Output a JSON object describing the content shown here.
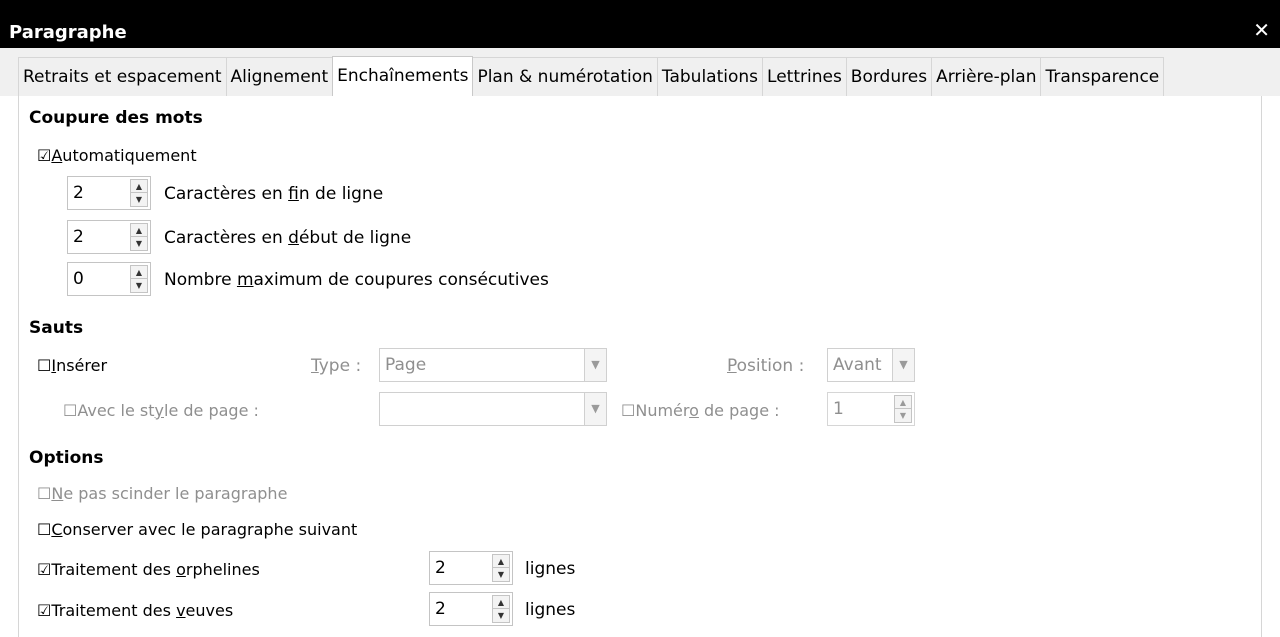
{
  "window": {
    "title": "Paragraphe",
    "close_glyph": "✕"
  },
  "tabs": [
    {
      "label": "Retraits et espacement"
    },
    {
      "label": "Alignement"
    },
    {
      "label": "Enchaînements"
    },
    {
      "label": "Plan & numérotation"
    },
    {
      "label": "Tabulations"
    },
    {
      "label": "Lettrines"
    },
    {
      "label": "Bordures"
    },
    {
      "label": "Arrière-plan"
    },
    {
      "label": "Transparence"
    }
  ],
  "hyphenation": {
    "heading": "Coupure des mots",
    "auto": {
      "checkbox": "☑",
      "label_u": "A",
      "label_rest": "utomatiquement"
    },
    "end_chars": {
      "value": "2",
      "label_pre": "Caractères en ",
      "label_u": "f",
      "label_post": "in de ligne"
    },
    "begin_chars": {
      "value": "2",
      "label_pre": "Caractères en ",
      "label_u": "d",
      "label_post": "ébut de ligne"
    },
    "max_hyphens": {
      "value": "0",
      "label_pre": "Nombre ",
      "label_u": "m",
      "label_post": "aximum de coupures consécutives"
    }
  },
  "breaks": {
    "heading": "Sauts",
    "insert": {
      "checkbox": "☐",
      "label_u": "I",
      "label_rest": "nsérer"
    },
    "type": {
      "label_u": "T",
      "label_rest": "ype :",
      "value": "Page"
    },
    "position": {
      "label_u": "P",
      "label_rest": "osition :",
      "value": "Avant"
    },
    "page_style": {
      "checkbox": "☐",
      "label_pre": "Avec le st",
      "label_u": "y",
      "label_post": "le de page :",
      "value": ""
    },
    "page_number": {
      "checkbox": "☐",
      "label_pre": "Numér",
      "label_u": "o",
      "label_post": " de page :",
      "value": "1"
    }
  },
  "options": {
    "heading": "Options",
    "keep_together": {
      "checkbox": "☐",
      "label_u": "N",
      "label_rest": "e pas scinder le paragraphe"
    },
    "keep_with_next": {
      "checkbox": "☐",
      "label_u": "C",
      "label_rest": "onserver avec le paragraphe suivant"
    },
    "orphans": {
      "checkbox": "☑",
      "label_pre": "Traitement des ",
      "label_u": "o",
      "label_post": "rphelines",
      "value": "2",
      "unit": "lignes"
    },
    "widows": {
      "checkbox": "☑",
      "label_pre": "Traitement des ",
      "label_u": "v",
      "label_post": "euves",
      "value": "2",
      "unit": "lignes"
    }
  }
}
